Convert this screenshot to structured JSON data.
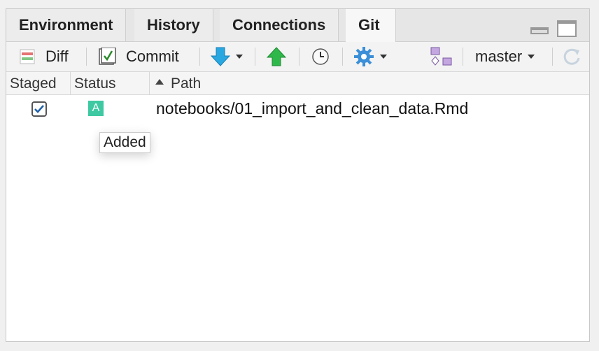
{
  "tabs": [
    {
      "label": "Environment",
      "active": false
    },
    {
      "label": "History",
      "active": false
    },
    {
      "label": "Connections",
      "active": false
    },
    {
      "label": "Git",
      "active": true
    }
  ],
  "toolbar": {
    "diff_label": "Diff",
    "commit_label": "Commit",
    "branch_label": "master",
    "icons": [
      "diff-icon",
      "commit-icon",
      "pull-icon",
      "push-icon",
      "history-icon",
      "gear-icon",
      "new-branch-icon",
      "refresh-icon"
    ]
  },
  "columns": {
    "staged": "Staged",
    "status": "Status",
    "path": "Path"
  },
  "rows": [
    {
      "staged": true,
      "status": "A",
      "path": "notebooks/01_import_and_clean_data.Rmd"
    }
  ],
  "tooltip": "Added",
  "colors": {
    "status_added": "#3ec9a2",
    "pull_arrow": "#29a7e1",
    "push_arrow": "#2fb84a",
    "gear": "#3a8fd8",
    "branch_icon": "#c4a6e0"
  }
}
